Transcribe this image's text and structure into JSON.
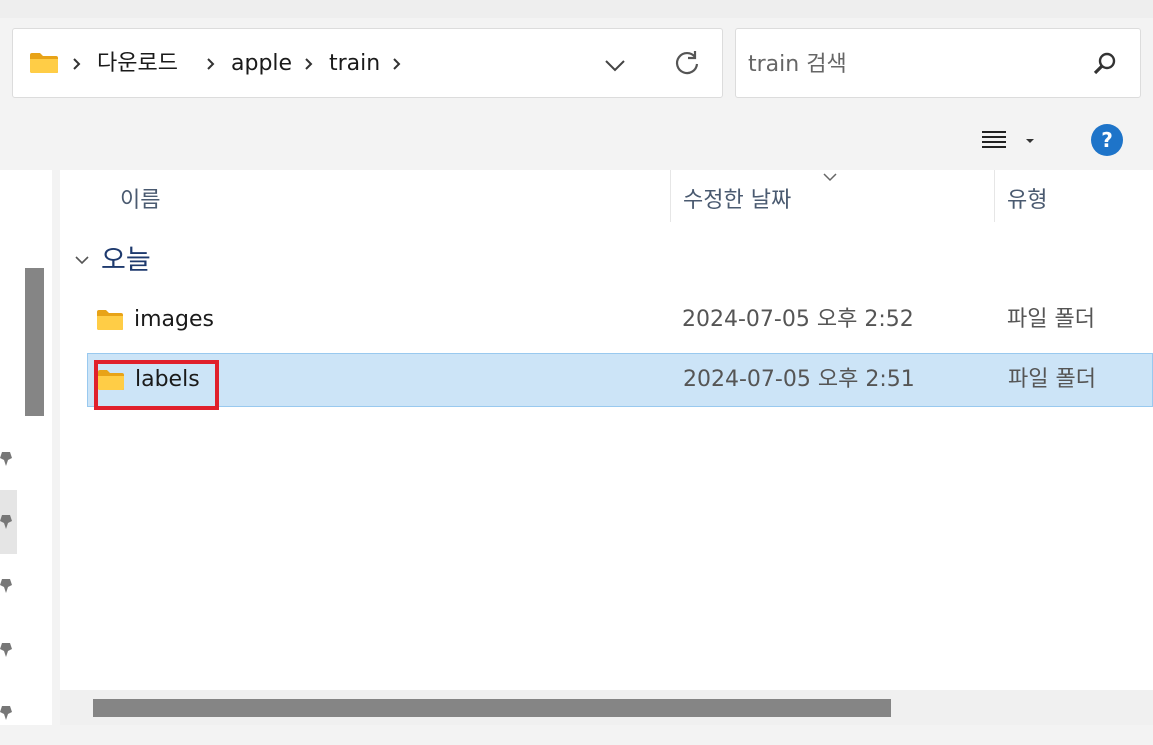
{
  "breadcrumb": {
    "items": [
      "다운로드",
      "apple",
      "train"
    ]
  },
  "address_icons": {
    "folder": "folder-icon",
    "dropdown": "chevron-down-icon",
    "refresh": "refresh-icon"
  },
  "search": {
    "placeholder": "train 검색",
    "icon": "search-icon"
  },
  "command_bar": {
    "view_icon": "list-view-icon",
    "help_label": "?"
  },
  "columns": {
    "name": "이름",
    "date": "수정한 날짜",
    "type": "유형"
  },
  "group": {
    "label": "오늘"
  },
  "files": [
    {
      "name": "images",
      "date": "2024-07-05 오후 2:52",
      "type": "파일 폴더",
      "selected": false
    },
    {
      "name": "labels",
      "date": "2024-07-05 오후 2:51",
      "type": "파일 폴더",
      "selected": true
    }
  ],
  "colors": {
    "selection": "#cce4f7",
    "highlight_box": "#e0202b",
    "folder": "#ffc83d",
    "help": "#1e74c9"
  }
}
